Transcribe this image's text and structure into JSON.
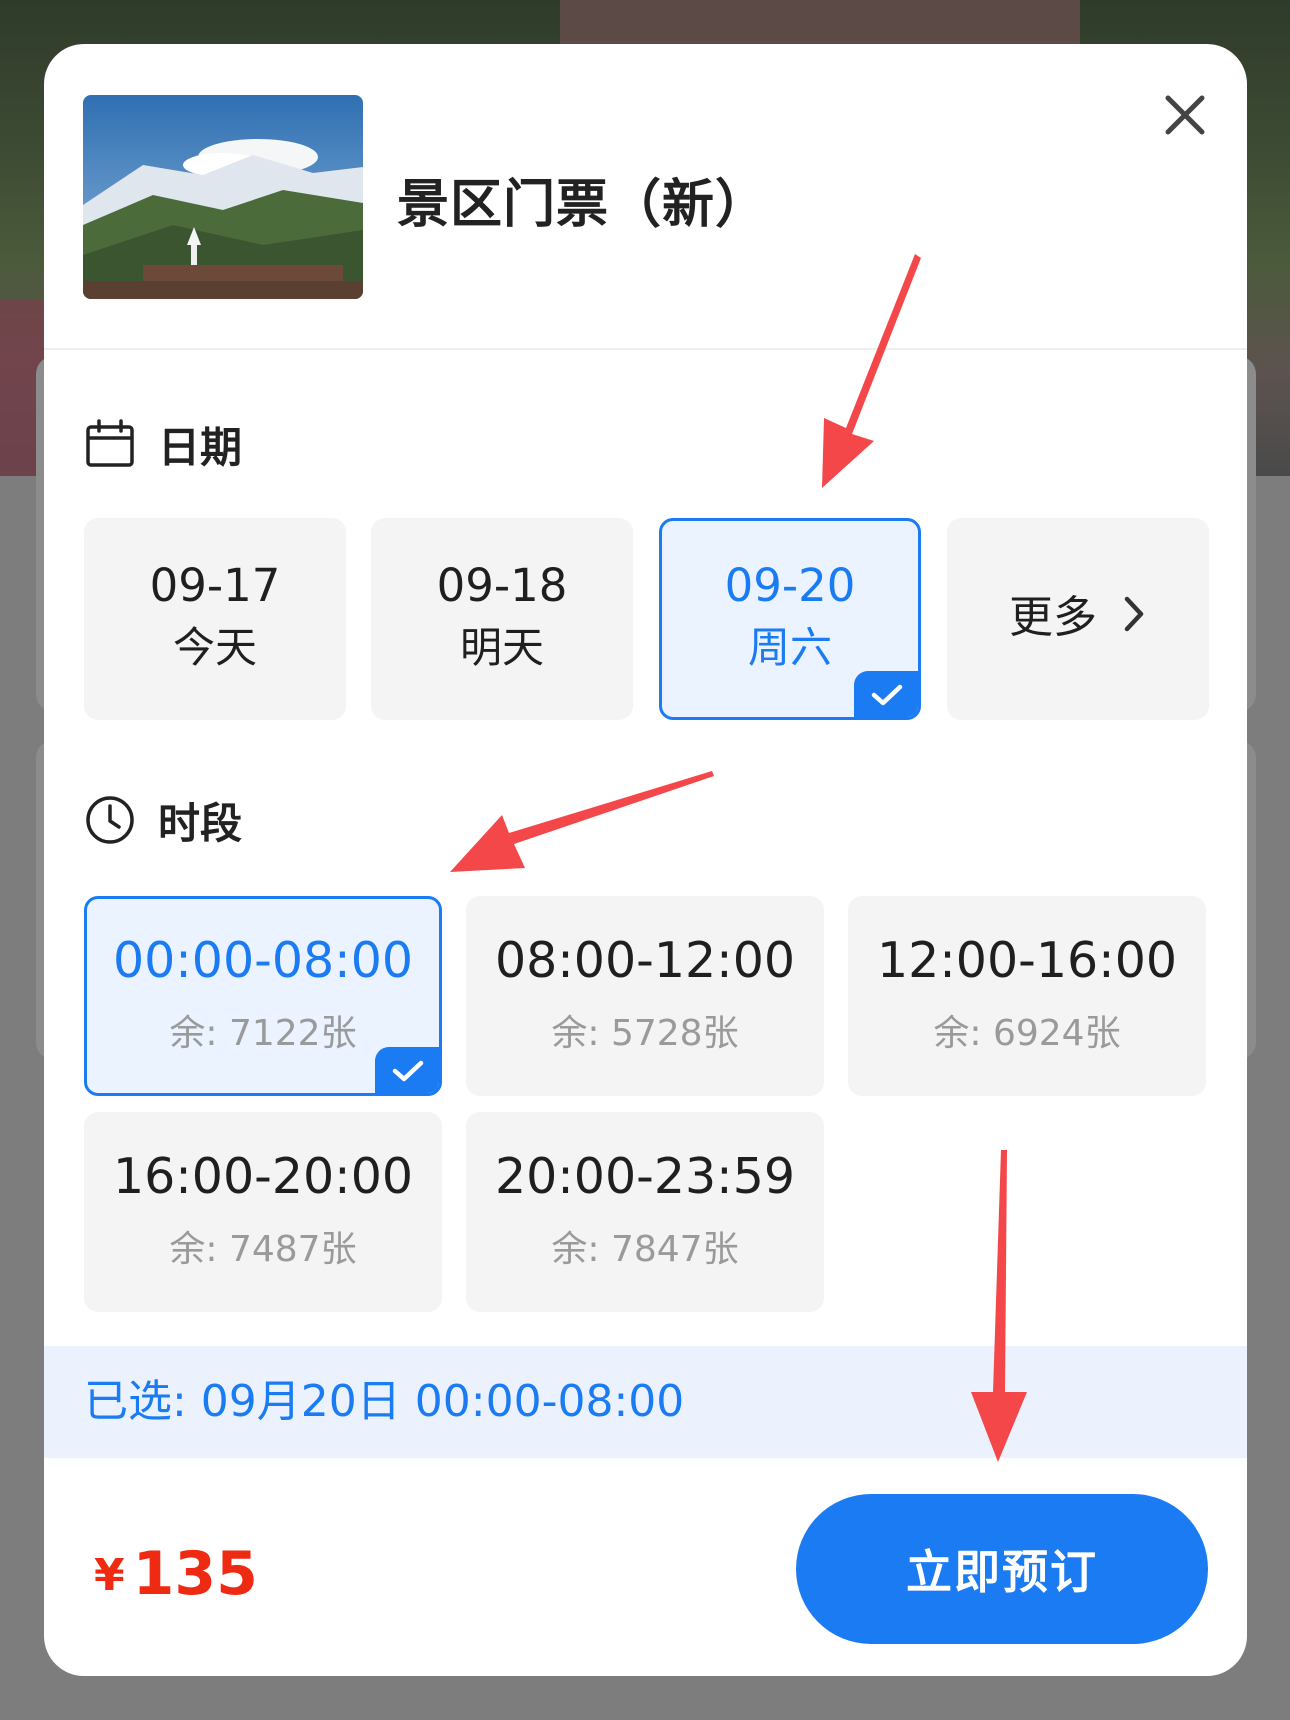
{
  "header": {
    "title": "景区门票（新）",
    "close_icon": "close-icon",
    "thumbnail_icon": "mountain-temple-photo"
  },
  "date_section": {
    "label": "日期",
    "icon": "calendar-icon",
    "options": [
      {
        "date": "09-17",
        "weekday": "今天",
        "selected": false
      },
      {
        "date": "09-18",
        "weekday": "明天",
        "selected": false
      },
      {
        "date": "09-20",
        "weekday": "周六",
        "selected": true
      }
    ],
    "more_label": "更多",
    "more_icon": "chevron-right-icon"
  },
  "slot_section": {
    "label": "时段",
    "icon": "clock-icon",
    "slots": [
      {
        "time": "00:00-08:00",
        "remaining": "余: 7122张",
        "selected": true
      },
      {
        "time": "08:00-12:00",
        "remaining": "余: 5728张",
        "selected": false
      },
      {
        "time": "12:00-16:00",
        "remaining": "余: 6924张",
        "selected": false
      },
      {
        "time": "16:00-20:00",
        "remaining": "余: 7487张",
        "selected": false
      },
      {
        "time": "20:00-23:59",
        "remaining": "余: 7847张",
        "selected": false
      }
    ]
  },
  "summary": {
    "selected_text": "已选: 09月20日 00:00-08:00"
  },
  "footer": {
    "currency": "¥",
    "price": "135",
    "book_label": "立即预订"
  },
  "colors": {
    "accent": "#1a7bf2",
    "price": "#ef2a12",
    "annotation_arrow": "#f4474a"
  }
}
